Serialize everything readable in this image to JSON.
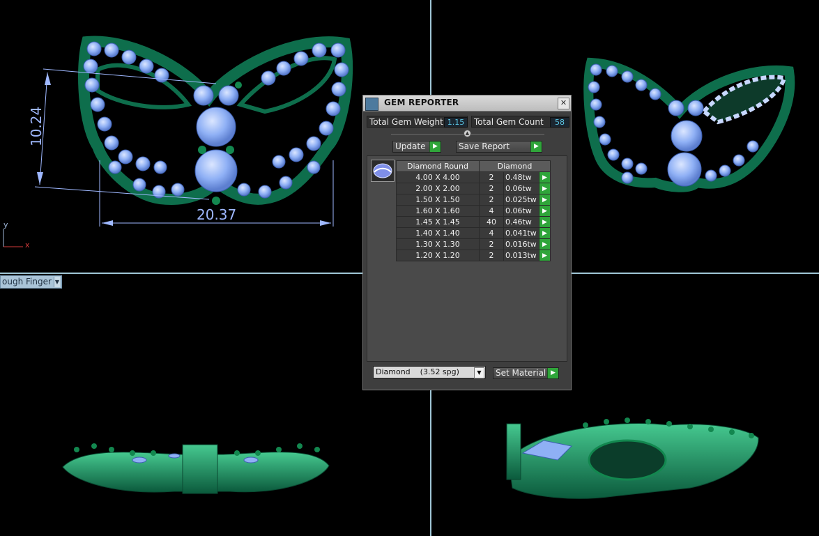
{
  "viewports": {
    "front_label": "ough Finger",
    "dimensions": {
      "height_value": "10.24",
      "width_value": "20.37"
    },
    "axes": {
      "y": "y",
      "x": "x"
    }
  },
  "gem_reporter": {
    "title": "GEM REPORTER",
    "close_glyph": "✕",
    "total_weight_label": "Total Gem Weight",
    "total_weight_value": "1.15",
    "total_count_label": "Total Gem Count",
    "total_count_value": "58",
    "update_label": "Update",
    "save_report_label": "Save Report",
    "table": {
      "headers": [
        "Diamond Round",
        "Diamond"
      ],
      "rows": [
        {
          "size": "4.00 X 4.00",
          "count": "2",
          "weight": "0.48tw"
        },
        {
          "size": "2.00 X 2.00",
          "count": "2",
          "weight": "0.06tw"
        },
        {
          "size": "1.50 X 1.50",
          "count": "2",
          "weight": "0.025tw"
        },
        {
          "size": "1.60 X 1.60",
          "count": "4",
          "weight": "0.06tw"
        },
        {
          "size": "1.45 X 1.45",
          "count": "40",
          "weight": "0.46tw"
        },
        {
          "size": "1.40 X 1.40",
          "count": "4",
          "weight": "0.041tw"
        },
        {
          "size": "1.30 X 1.30",
          "count": "2",
          "weight": "0.016tw"
        },
        {
          "size": "1.20 X 1.20",
          "count": "2",
          "weight": "0.013tw"
        }
      ]
    },
    "material_select_value": "Diamond    (3.52 spg)",
    "set_material_label": "Set Material"
  },
  "colors": {
    "metal": "#0e6e4c",
    "gem": "#8fb0f5",
    "dimension": "#9fb8ff",
    "viewport_divider": "#9fc6d6",
    "go_button": "#2fa53a"
  }
}
